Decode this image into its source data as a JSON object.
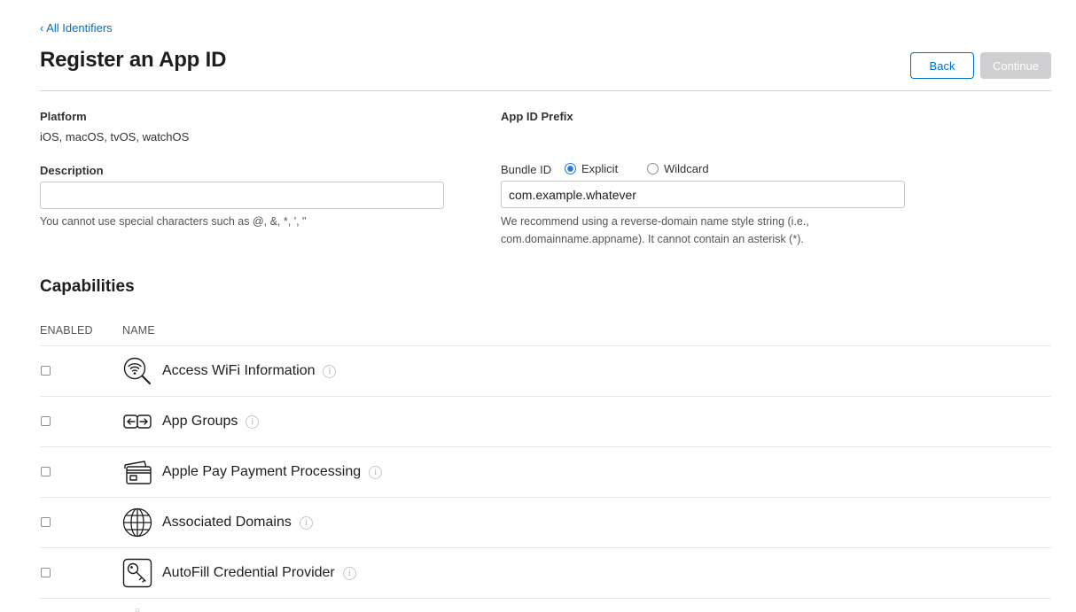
{
  "nav": {
    "back_link": "‹ All Identifiers"
  },
  "header": {
    "title": "Register an App ID",
    "back_button": "Back",
    "continue_button": "Continue"
  },
  "platform": {
    "label": "Platform",
    "value": "iOS, macOS, tvOS, watchOS"
  },
  "app_id_prefix": {
    "label": "App ID Prefix",
    "value": ""
  },
  "description": {
    "label": "Description",
    "value": "",
    "helper": "You cannot use special characters such as @, &, *, ', \""
  },
  "bundle_id": {
    "label": "Bundle ID",
    "options": [
      "Explicit",
      "Wildcard"
    ],
    "selected": "Explicit",
    "value": "com.example.whatever",
    "helper_line1": "We recommend using a reverse-domain name style string (i.e.,",
    "helper_line2": "com.domainname.appname). It cannot contain an asterisk (*)."
  },
  "capabilities": {
    "title": "Capabilities",
    "columns": [
      "ENABLED",
      "NAME"
    ],
    "items": [
      {
        "name": "Access WiFi Information",
        "icon": "wifi-search-icon",
        "enabled": false
      },
      {
        "name": "App Groups",
        "icon": "app-groups-icon",
        "enabled": false
      },
      {
        "name": "Apple Pay Payment Processing",
        "icon": "credit-card-icon",
        "enabled": false
      },
      {
        "name": "Associated Domains",
        "icon": "globe-icon",
        "enabled": false
      },
      {
        "name": "AutoFill Credential Provider",
        "icon": "key-icon",
        "enabled": false
      }
    ],
    "info_glyph": "i"
  },
  "colors": {
    "accent": "#0070c9",
    "radio_selected": "#1e78e6",
    "disabled_button": "#cfcfd1",
    "divider": "#d2d2d7"
  }
}
